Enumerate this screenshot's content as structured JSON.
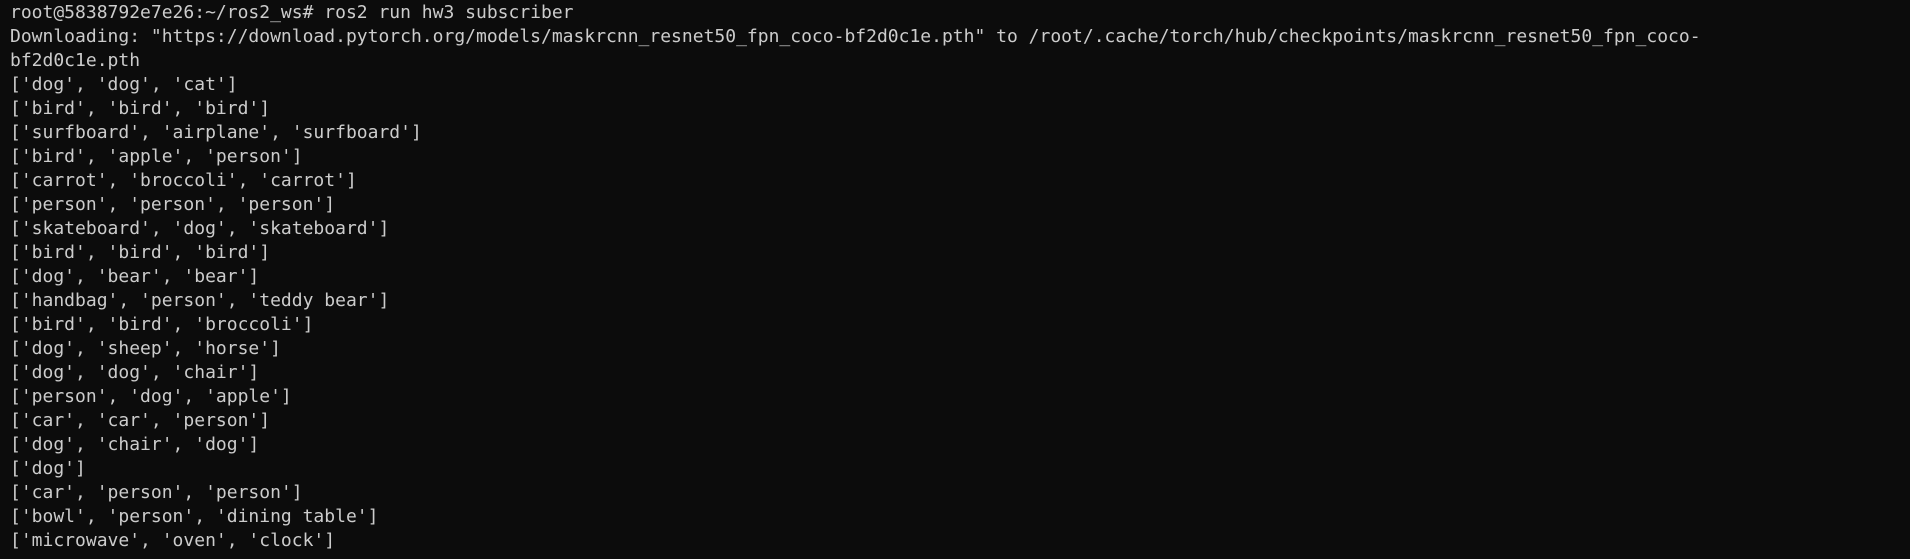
{
  "terminal": {
    "lines": [
      "root@5838792e7e26:~/ros2_ws# ros2 run hw3 subscriber",
      "Downloading: \"https://download.pytorch.org/models/maskrcnn_resnet50_fpn_coco-bf2d0c1e.pth\" to /root/.cache/torch/hub/checkpoints/maskrcnn_resnet50_fpn_coco-",
      "bf2d0c1e.pth",
      "['dog', 'dog', 'cat']",
      "['bird', 'bird', 'bird']",
      "['surfboard', 'airplane', 'surfboard']",
      "['bird', 'apple', 'person']",
      "['carrot', 'broccoli', 'carrot']",
      "['person', 'person', 'person']",
      "['skateboard', 'dog', 'skateboard']",
      "['bird', 'bird', 'bird']",
      "['dog', 'bear', 'bear']",
      "['handbag', 'person', 'teddy bear']",
      "['bird', 'bird', 'broccoli']",
      "['dog', 'sheep', 'horse']",
      "['dog', 'dog', 'chair']",
      "['person', 'dog', 'apple']",
      "['car', 'car', 'person']",
      "['dog', 'chair', 'dog']",
      "['dog']",
      "['car', 'person', 'person']",
      "['bowl', 'person', 'dining table']",
      "['microwave', 'oven', 'clock']"
    ]
  },
  "colors": {
    "background": "#0c0c0c",
    "foreground": "#cccccc"
  }
}
